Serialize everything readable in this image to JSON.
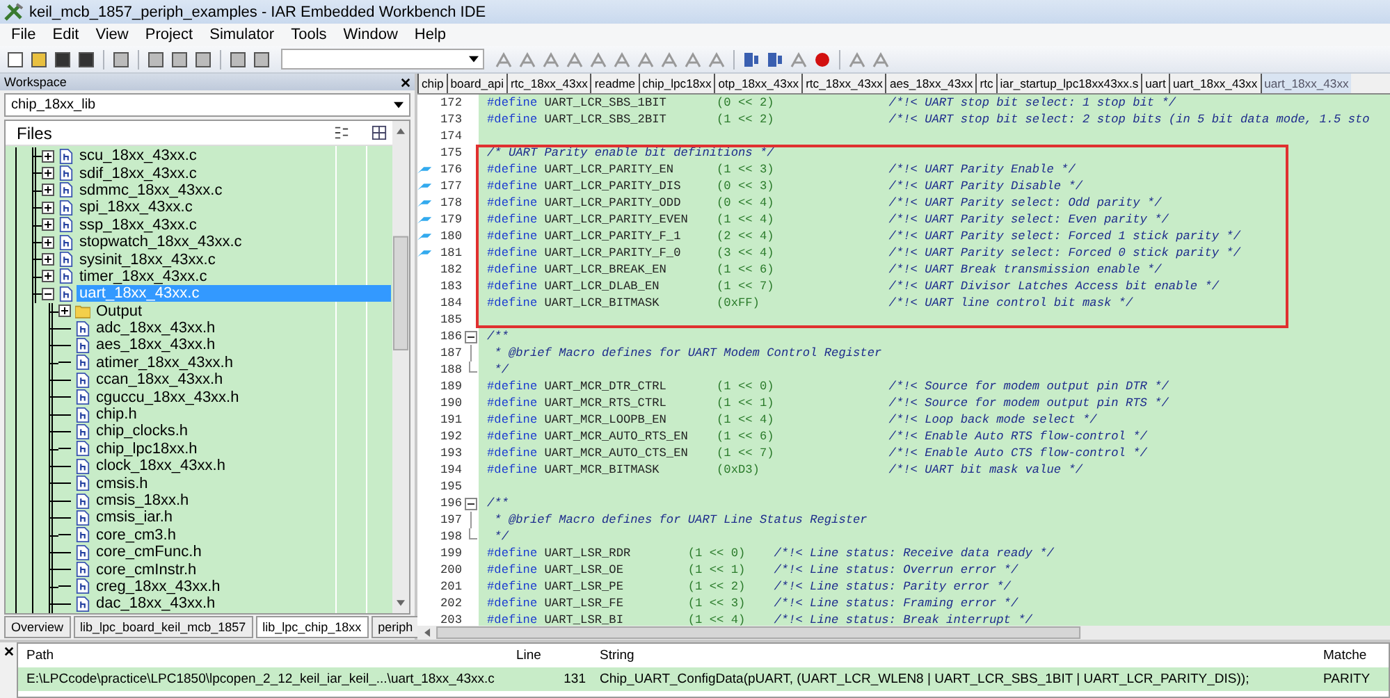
{
  "window": {
    "title": "keil_mcb_1857_periph_examples - IAR Embedded Workbench IDE"
  },
  "menu": [
    "File",
    "Edit",
    "View",
    "Project",
    "Simulator",
    "Tools",
    "Window",
    "Help"
  ],
  "workspace": {
    "title": "Workspace",
    "config": "chip_18xx_lib",
    "files_header": "Files",
    "tree": [
      {
        "label": "scu_18xx_43xx.c",
        "kind": "c",
        "expanded": false,
        "selected": false
      },
      {
        "label": "sdif_18xx_43xx.c",
        "kind": "c",
        "expanded": false,
        "selected": false
      },
      {
        "label": "sdmmc_18xx_43xx.c",
        "kind": "c",
        "expanded": false,
        "selected": false
      },
      {
        "label": "spi_18xx_43xx.c",
        "kind": "c",
        "expanded": false,
        "selected": false
      },
      {
        "label": "ssp_18xx_43xx.c",
        "kind": "c",
        "expanded": false,
        "selected": false
      },
      {
        "label": "stopwatch_18xx_43xx.c",
        "kind": "c",
        "expanded": false,
        "selected": false
      },
      {
        "label": "sysinit_18xx_43xx.c",
        "kind": "c",
        "expanded": false,
        "selected": false
      },
      {
        "label": "timer_18xx_43xx.c",
        "kind": "c",
        "expanded": false,
        "selected": false
      },
      {
        "label": "uart_18xx_43xx.c",
        "kind": "c",
        "expanded": true,
        "selected": true,
        "children": [
          {
            "label": "Output",
            "kind": "folder",
            "expanded": false,
            "selected": false
          },
          {
            "label": "adc_18xx_43xx.h",
            "kind": "h",
            "selected": false
          },
          {
            "label": "aes_18xx_43xx.h",
            "kind": "h",
            "selected": false
          },
          {
            "label": "atimer_18xx_43xx.h",
            "kind": "h",
            "selected": false
          },
          {
            "label": "ccan_18xx_43xx.h",
            "kind": "h",
            "selected": false
          },
          {
            "label": "cguccu_18xx_43xx.h",
            "kind": "h",
            "selected": false
          },
          {
            "label": "chip.h",
            "kind": "h",
            "selected": false
          },
          {
            "label": "chip_clocks.h",
            "kind": "h",
            "selected": false
          },
          {
            "label": "chip_lpc18xx.h",
            "kind": "h",
            "selected": false
          },
          {
            "label": "clock_18xx_43xx.h",
            "kind": "h",
            "selected": false
          },
          {
            "label": "cmsis.h",
            "kind": "h",
            "selected": false
          },
          {
            "label": "cmsis_18xx.h",
            "kind": "h",
            "selected": false
          },
          {
            "label": "cmsis_iar.h",
            "kind": "h",
            "selected": false
          },
          {
            "label": "core_cm3.h",
            "kind": "h",
            "selected": false
          },
          {
            "label": "core_cmFunc.h",
            "kind": "h",
            "selected": false
          },
          {
            "label": "core_cmInstr.h",
            "kind": "h",
            "selected": false
          },
          {
            "label": "creg_18xx_43xx.h",
            "kind": "h",
            "selected": false
          },
          {
            "label": "dac_18xx_43xx.h",
            "kind": "h",
            "selected": false
          }
        ]
      }
    ],
    "tabs": [
      {
        "label": "Overview",
        "selected": false
      },
      {
        "label": "lib_lpc_board_keil_mcb_1857",
        "selected": false
      },
      {
        "label": "lib_lpc_chip_18xx",
        "selected": true
      },
      {
        "label": "periph",
        "selected": false
      }
    ]
  },
  "editor": {
    "tabs": [
      {
        "label": "chip",
        "selected": false
      },
      {
        "label": "board_api",
        "selected": false
      },
      {
        "label": "rtc_18xx_43xx",
        "selected": false
      },
      {
        "label": "readme",
        "selected": false
      },
      {
        "label": "chip_lpc18xx",
        "selected": false
      },
      {
        "label": "otp_18xx_43xx",
        "selected": false
      },
      {
        "label": "rtc_18xx_43xx",
        "selected": false
      },
      {
        "label": "aes_18xx_43xx",
        "selected": false
      },
      {
        "label": "rtc",
        "selected": false
      },
      {
        "label": "iar_startup_lpc18xx43xx.s",
        "selected": false
      },
      {
        "label": "uart",
        "selected": false
      },
      {
        "label": "uart_18xx_43xx",
        "selected": false
      },
      {
        "label": "uart_18xx_43xx",
        "selected": true
      }
    ],
    "lines": [
      {
        "n": "172",
        "kind": "define",
        "directive": "#define",
        "name": "UART_LCR_SBS_1BIT",
        "value": "(0 << 2)",
        "comment": "/*!< UART stop bit select: 1 stop bit */"
      },
      {
        "n": "173",
        "kind": "define",
        "directive": "#define",
        "name": "UART_LCR_SBS_2BIT",
        "value": "(1 << 2)",
        "comment": "/*!< UART stop bit select: 2 stop bits (in 5 bit data mode, 1.5 sto"
      },
      {
        "n": "174",
        "kind": "blank"
      },
      {
        "n": "175",
        "kind": "comment",
        "text": "/* UART Parity enable bit definitions */",
        "boxed": true
      },
      {
        "n": "176",
        "kind": "define",
        "directive": "#define",
        "name": "UART_LCR_PARITY_EN",
        "value": "(1 << 3)",
        "comment": "/*!< UART Parity Enable */",
        "boxed": true,
        "bookmark": true
      },
      {
        "n": "177",
        "kind": "define",
        "directive": "#define",
        "name": "UART_LCR_PARITY_DIS",
        "value": "(0 << 3)",
        "comment": "/*!< UART Parity Disable */",
        "boxed": true,
        "bookmark": true
      },
      {
        "n": "178",
        "kind": "define",
        "directive": "#define",
        "name": "UART_LCR_PARITY_ODD",
        "value": "(0 << 4)",
        "comment": "/*!< UART Parity select: Odd parity */",
        "boxed": true,
        "bookmark": true
      },
      {
        "n": "179",
        "kind": "define",
        "directive": "#define",
        "name": "UART_LCR_PARITY_EVEN",
        "value": "(1 << 4)",
        "comment": "/*!< UART Parity select: Even parity */",
        "boxed": true,
        "bookmark": true
      },
      {
        "n": "180",
        "kind": "define",
        "directive": "#define",
        "name": "UART_LCR_PARITY_F_1",
        "value": "(2 << 4)",
        "comment": "/*!< UART Parity select: Forced 1 stick parity */",
        "boxed": true,
        "bookmark": true
      },
      {
        "n": "181",
        "kind": "define",
        "directive": "#define",
        "name": "UART_LCR_PARITY_F_0",
        "value": "(3 << 4)",
        "comment": "/*!< UART Parity select: Forced 0 stick parity */",
        "boxed": true,
        "bookmark": true
      },
      {
        "n": "182",
        "kind": "define",
        "directive": "#define",
        "name": "UART_LCR_BREAK_EN",
        "value": "(1 << 6)",
        "comment": "/*!< UART Break transmission enable */",
        "boxed": true
      },
      {
        "n": "183",
        "kind": "define",
        "directive": "#define",
        "name": "UART_LCR_DLAB_EN",
        "value": "(1 << 7)",
        "comment": "/*!< UART Divisor Latches Access bit enable */",
        "boxed": true
      },
      {
        "n": "184",
        "kind": "define",
        "directive": "#define",
        "name": "UART_LCR_BITMASK",
        "value": "(0xFF)",
        "comment": "/*!< UART line control bit mask */",
        "boxed": true
      },
      {
        "n": "185",
        "kind": "blank",
        "boxed": true
      },
      {
        "n": "186",
        "kind": "comment",
        "text": "/**",
        "fold_start": true
      },
      {
        "n": "187",
        "kind": "comment",
        "text": " * @brief Macro defines for UART Modem Control Register"
      },
      {
        "n": "188",
        "kind": "comment",
        "text": " */",
        "fold_end": true
      },
      {
        "n": "189",
        "kind": "define",
        "directive": "#define",
        "name": "UART_MCR_DTR_CTRL",
        "value": "(1 << 0)",
        "comment": "/*!< Source for modem output pin DTR */"
      },
      {
        "n": "190",
        "kind": "define",
        "directive": "#define",
        "name": "UART_MCR_RTS_CTRL",
        "value": "(1 << 1)",
        "comment": "/*!< Source for modem output pin RTS */"
      },
      {
        "n": "191",
        "kind": "define",
        "directive": "#define",
        "name": "UART_MCR_LOOPB_EN",
        "value": "(1 << 4)",
        "comment": "/*!< Loop back mode select */"
      },
      {
        "n": "192",
        "kind": "define",
        "directive": "#define",
        "name": "UART_MCR_AUTO_RTS_EN",
        "value": "(1 << 6)",
        "comment": "/*!< Enable Auto RTS flow-control */"
      },
      {
        "n": "193",
        "kind": "define",
        "directive": "#define",
        "name": "UART_MCR_AUTO_CTS_EN",
        "value": "(1 << 7)",
        "comment": "/*!< Enable Auto CTS flow-control */"
      },
      {
        "n": "194",
        "kind": "define",
        "directive": "#define",
        "name": "UART_MCR_BITMASK",
        "value": "(0xD3)",
        "comment": "/*!< UART bit mask value */"
      },
      {
        "n": "195",
        "kind": "blank"
      },
      {
        "n": "196",
        "kind": "comment",
        "text": "/**",
        "fold_start": true
      },
      {
        "n": "197",
        "kind": "comment",
        "text": " * @brief Macro defines for UART Line Status Register"
      },
      {
        "n": "198",
        "kind": "comment",
        "text": " */",
        "fold_end": true
      },
      {
        "n": "199",
        "kind": "define",
        "directive": "#define",
        "name": "UART_LSR_RDR",
        "value": "(1 << 0)",
        "comment": "/*!< Line status: Receive data ready */"
      },
      {
        "n": "200",
        "kind": "define",
        "directive": "#define",
        "name": "UART_LSR_OE",
        "value": "(1 << 1)",
        "comment": "/*!< Line status: Overrun error */"
      },
      {
        "n": "201",
        "kind": "define",
        "directive": "#define",
        "name": "UART_LSR_PE",
        "value": "(1 << 2)",
        "comment": "/*!< Line status: Parity error */"
      },
      {
        "n": "202",
        "kind": "define",
        "directive": "#define",
        "name": "UART_LSR_FE",
        "value": "(1 << 3)",
        "comment": "/*!< Line status: Framing error */"
      },
      {
        "n": "203",
        "kind": "define",
        "directive": "#define",
        "name": "UART_LSR_BI",
        "value": "(1 << 4)",
        "comment": "/*!< Line status: Break interrupt */"
      }
    ]
  },
  "find_results": {
    "columns": [
      "Path",
      "Line",
      "String",
      "Matche"
    ],
    "rows": [
      {
        "path": "E:\\LPCcode\\practice\\LPC1850\\lpcopen_2_12_keil_iar_keil_...\\uart_18xx_43xx.c",
        "line": "131",
        "string": "Chip_UART_ConfigData(pUART, (UART_LCR_WLEN8 | UART_LCR_SBS_1BIT | UART_LCR_PARITY_DIS));",
        "matches": "PARITY"
      }
    ]
  }
}
